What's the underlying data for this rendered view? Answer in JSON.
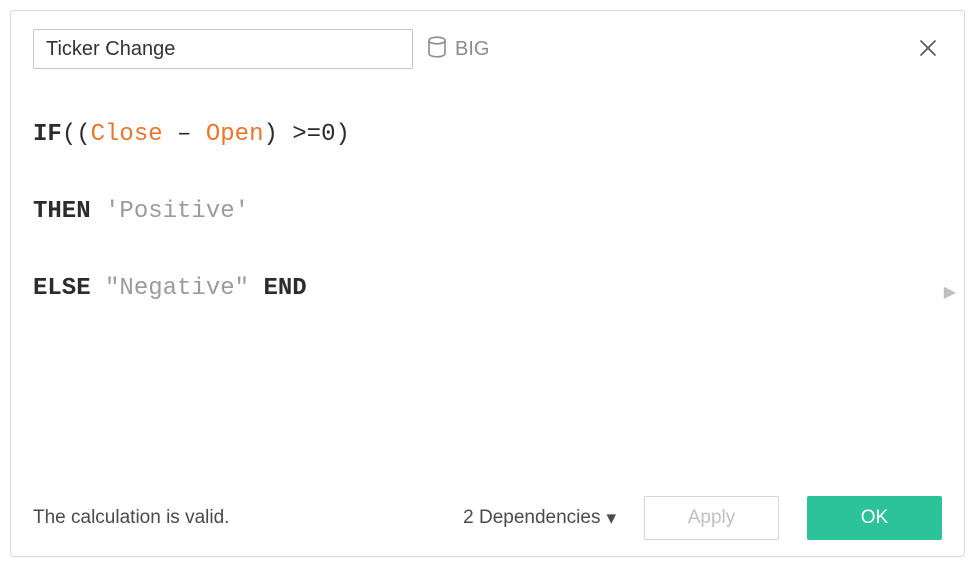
{
  "header": {
    "calc_name": "Ticker Change",
    "datasource_label": "BIG"
  },
  "formula": {
    "tokens": [
      {
        "t": "kw",
        "v": "IF"
      },
      {
        "t": "plain",
        "v": "(("
      },
      {
        "t": "field",
        "v": "Close"
      },
      {
        "t": "plain",
        "v": " – "
      },
      {
        "t": "field",
        "v": "Open"
      },
      {
        "t": "plain",
        "v": ") >=0)"
      },
      {
        "t": "br2",
        "v": ""
      },
      {
        "t": "kw",
        "v": "THEN"
      },
      {
        "t": "plain",
        "v": " "
      },
      {
        "t": "str",
        "v": "'Positive'"
      },
      {
        "t": "br2",
        "v": ""
      },
      {
        "t": "kw",
        "v": "ELSE"
      },
      {
        "t": "plain",
        "v": " "
      },
      {
        "t": "str",
        "v": "\"Negative\""
      },
      {
        "t": "plain",
        "v": " "
      },
      {
        "t": "kw",
        "v": "END"
      }
    ]
  },
  "footer": {
    "status_text": "The calculation is valid.",
    "dependencies_label": "2 Dependencies",
    "apply_label": "Apply",
    "ok_label": "OK"
  }
}
